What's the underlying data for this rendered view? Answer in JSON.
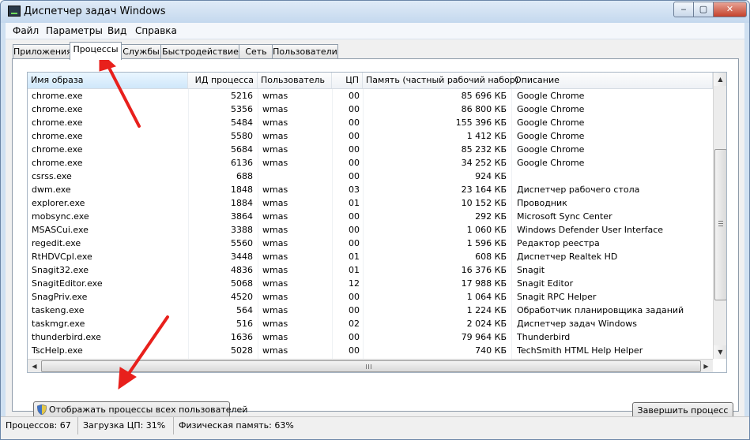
{
  "window": {
    "title": "Диспетчер задач Windows",
    "controls": {
      "minimize": "‒",
      "maximize": "▢",
      "close": "✕"
    }
  },
  "menu": [
    "Файл",
    "Параметры",
    "Вид",
    "Справка"
  ],
  "tabs": [
    {
      "label": "Приложения",
      "active": false
    },
    {
      "label": "Процессы",
      "active": true
    },
    {
      "label": "Службы",
      "active": false
    },
    {
      "label": "Быстродействие",
      "active": false
    },
    {
      "label": "Сеть",
      "active": false
    },
    {
      "label": "Пользователи",
      "active": false
    }
  ],
  "columns": {
    "name": "Имя образа",
    "pid": "ИД процесса",
    "user": "Пользователь",
    "cpu": "ЦП",
    "memory": "Память (частный рабочий набор)",
    "description": "Описание"
  },
  "processes": [
    {
      "name": "chrome.exe",
      "pid": "5216",
      "user": "wmas",
      "cpu": "00",
      "memory": "85 696 КБ",
      "description": "Google Chrome"
    },
    {
      "name": "chrome.exe",
      "pid": "5356",
      "user": "wmas",
      "cpu": "00",
      "memory": "86 800 КБ",
      "description": "Google Chrome"
    },
    {
      "name": "chrome.exe",
      "pid": "5484",
      "user": "wmas",
      "cpu": "00",
      "memory": "155 396 КБ",
      "description": "Google Chrome"
    },
    {
      "name": "chrome.exe",
      "pid": "5580",
      "user": "wmas",
      "cpu": "00",
      "memory": "1 412 КБ",
      "description": "Google Chrome"
    },
    {
      "name": "chrome.exe",
      "pid": "5684",
      "user": "wmas",
      "cpu": "00",
      "memory": "85 232 КБ",
      "description": "Google Chrome"
    },
    {
      "name": "chrome.exe",
      "pid": "6136",
      "user": "wmas",
      "cpu": "00",
      "memory": "34 252 КБ",
      "description": "Google Chrome"
    },
    {
      "name": "csrss.exe",
      "pid": "688",
      "user": "",
      "cpu": "00",
      "memory": "924 КБ",
      "description": ""
    },
    {
      "name": "dwm.exe",
      "pid": "1848",
      "user": "wmas",
      "cpu": "03",
      "memory": "23 164 КБ",
      "description": "Диспетчер рабочего стола"
    },
    {
      "name": "explorer.exe",
      "pid": "1884",
      "user": "wmas",
      "cpu": "01",
      "memory": "10 152 КБ",
      "description": "Проводник"
    },
    {
      "name": "mobsync.exe",
      "pid": "3864",
      "user": "wmas",
      "cpu": "00",
      "memory": "292 КБ",
      "description": "Microsoft Sync Center"
    },
    {
      "name": "MSASCui.exe",
      "pid": "3388",
      "user": "wmas",
      "cpu": "00",
      "memory": "1 060 КБ",
      "description": "Windows Defender User Interface"
    },
    {
      "name": "regedit.exe",
      "pid": "5560",
      "user": "wmas",
      "cpu": "00",
      "memory": "1 596 КБ",
      "description": "Редактор реестра"
    },
    {
      "name": "RtHDVCpl.exe",
      "pid": "3448",
      "user": "wmas",
      "cpu": "01",
      "memory": "608 КБ",
      "description": "Диспетчер Realtek HD"
    },
    {
      "name": "Snagit32.exe",
      "pid": "4836",
      "user": "wmas",
      "cpu": "01",
      "memory": "16 376 КБ",
      "description": "Snagit"
    },
    {
      "name": "SnagitEditor.exe",
      "pid": "5068",
      "user": "wmas",
      "cpu": "12",
      "memory": "17 988 КБ",
      "description": "Snagit Editor"
    },
    {
      "name": "SnagPriv.exe",
      "pid": "4520",
      "user": "wmas",
      "cpu": "00",
      "memory": "1 064 КБ",
      "description": "Snagit RPC Helper"
    },
    {
      "name": "taskeng.exe",
      "pid": "564",
      "user": "wmas",
      "cpu": "00",
      "memory": "1 224 КБ",
      "description": "Обработчик планировщика заданий"
    },
    {
      "name": "taskmgr.exe",
      "pid": "516",
      "user": "wmas",
      "cpu": "02",
      "memory": "2 024 КБ",
      "description": "Диспетчер задач Windows"
    },
    {
      "name": "thunderbird.exe",
      "pid": "1636",
      "user": "wmas",
      "cpu": "00",
      "memory": "79 964 КБ",
      "description": "Thunderbird"
    },
    {
      "name": "TscHelp.exe",
      "pid": "5028",
      "user": "wmas",
      "cpu": "00",
      "memory": "740 КБ",
      "description": "TechSmith HTML Help Helper"
    }
  ],
  "buttons": {
    "show_all": "Отображать процессы всех пользователей",
    "end_process": "Завершить процесс"
  },
  "status": {
    "processes": "Процессов: 67",
    "cpu": "Загрузка ЦП: 31%",
    "memory": "Физическая память: 63%"
  },
  "colors": {
    "annotation_arrow": "#e8201c",
    "window_frame": "#cfe0f1",
    "selected_column": "#cfe7fa"
  }
}
